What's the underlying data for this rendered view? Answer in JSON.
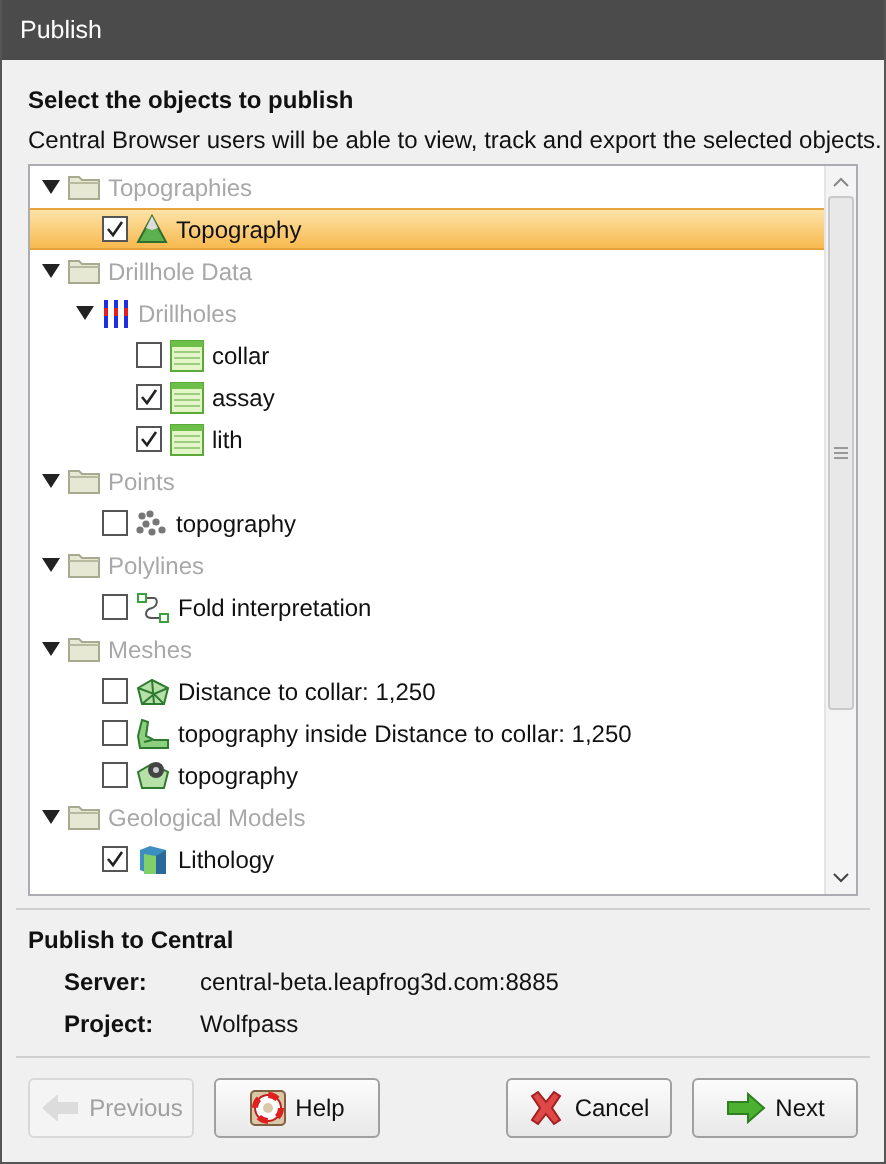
{
  "window": {
    "title": "Publish"
  },
  "heading": "Select the objects to publish",
  "description": "Central Browser users will be able to view, track and export the selected objects.",
  "tree": [
    {
      "kind": "folder",
      "label": "Topographies",
      "expanded": true,
      "children": [
        {
          "kind": "surface",
          "label": "Topography",
          "checked": true,
          "selected": true
        }
      ]
    },
    {
      "kind": "folder",
      "label": "Drillhole Data",
      "expanded": true,
      "children": [
        {
          "kind": "drillholes",
          "label": "Drillholes",
          "expanded": true,
          "children": [
            {
              "kind": "table",
              "label": "collar",
              "checked": false,
              "selected": false
            },
            {
              "kind": "table",
              "label": "assay",
              "checked": true,
              "selected": false
            },
            {
              "kind": "table",
              "label": "lith",
              "checked": true,
              "selected": false
            }
          ]
        }
      ]
    },
    {
      "kind": "folder",
      "label": "Points",
      "expanded": true,
      "children": [
        {
          "kind": "points",
          "label": "topography",
          "checked": false,
          "selected": false
        }
      ]
    },
    {
      "kind": "folder",
      "label": "Polylines",
      "expanded": true,
      "children": [
        {
          "kind": "polyline",
          "label": "Fold interpretation",
          "checked": false,
          "selected": false
        }
      ]
    },
    {
      "kind": "folder",
      "label": "Meshes",
      "expanded": true,
      "children": [
        {
          "kind": "mesh",
          "label": "Distance to collar: 1,250",
          "checked": false,
          "selected": false
        },
        {
          "kind": "mesh-clip",
          "label": "topography inside Distance to collar: 1,250",
          "checked": false,
          "selected": false
        },
        {
          "kind": "mesh-gear",
          "label": "topography",
          "checked": false,
          "selected": false
        }
      ]
    },
    {
      "kind": "folder",
      "label": "Geological Models",
      "expanded": true,
      "children": [
        {
          "kind": "model",
          "label": "Lithology",
          "checked": true,
          "selected": false
        }
      ]
    }
  ],
  "publish": {
    "heading": "Publish to Central",
    "fields": [
      {
        "label": "Server:",
        "value": "central-beta.leapfrog3d.com:8885"
      },
      {
        "label": "Project:",
        "value": "Wolfpass"
      }
    ]
  },
  "buttons": [
    {
      "kind": "previous",
      "label": "Previous",
      "disabled": true
    },
    {
      "kind": "help",
      "label": "Help",
      "disabled": false
    },
    {
      "kind": "cancel",
      "label": "Cancel",
      "disabled": false
    },
    {
      "kind": "next",
      "label": "Next",
      "disabled": false
    }
  ]
}
